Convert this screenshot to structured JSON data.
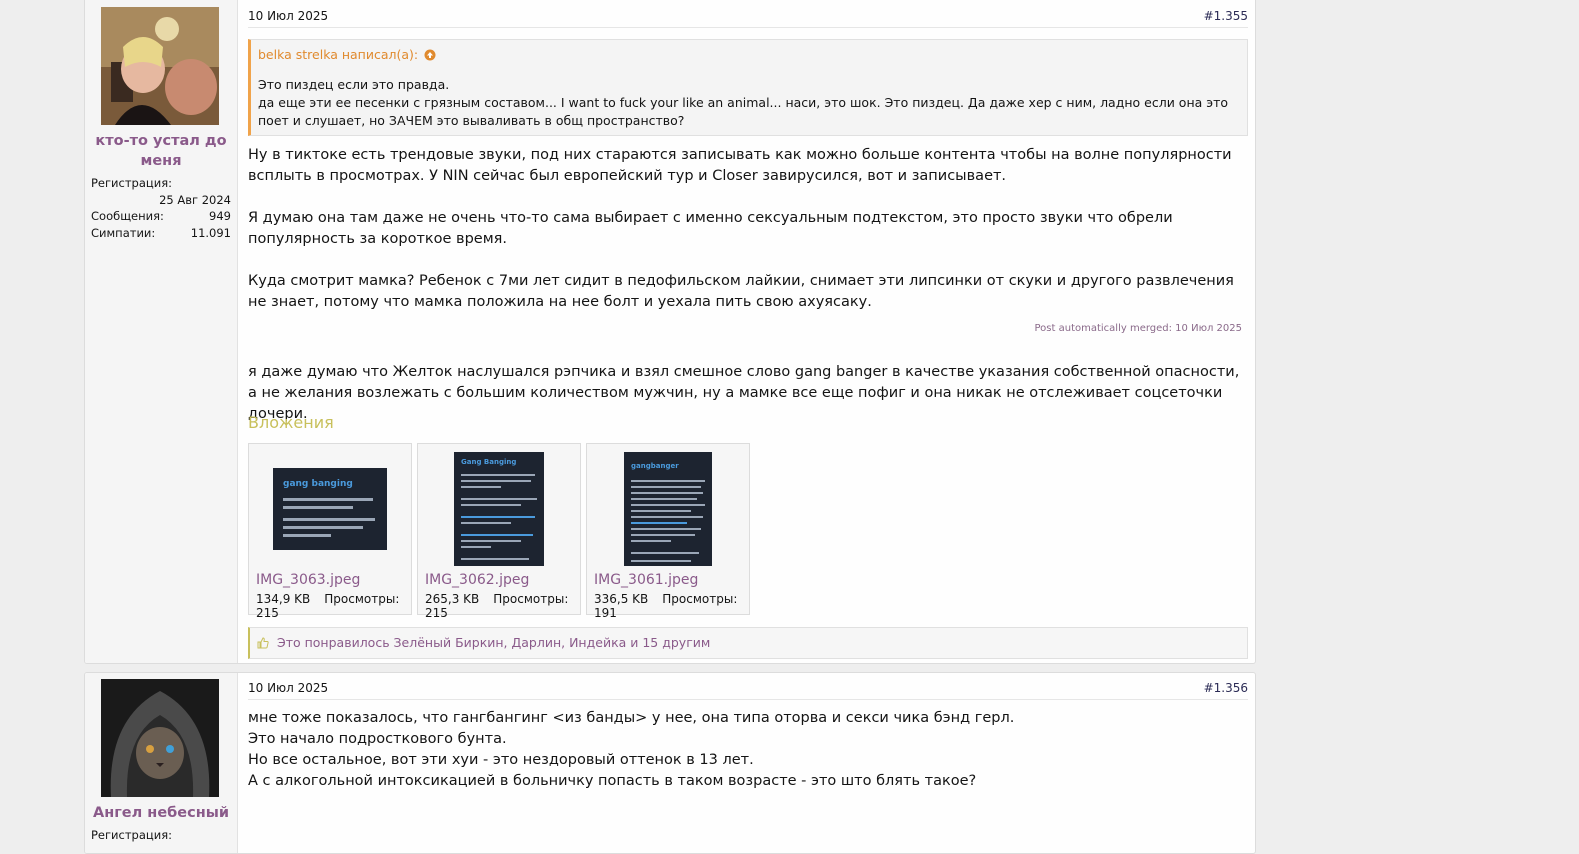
{
  "posts": [
    {
      "username": "кто-то устал до меня",
      "stats": {
        "reg_label": "Регистрация:",
        "reg_value": "25 Авг 2024",
        "msgs_label": "Сообщения:",
        "msgs_value": "949",
        "likes_label": "Симпатии:",
        "likes_value": "11.091"
      },
      "date": "10 Июл 2025",
      "number": "#1.355",
      "quote": {
        "author": "belka strelka написал(а):",
        "line1": "Это пиздец если это правда.",
        "line2": "да еще эти ее песенки с грязным составом... I want to fuck your like an animal... наси, это шок. Это пиздец. Да даже хер с ним, ладно если она это поет и слушает, но ЗАЧЕМ это вываливать в общ пространство?"
      },
      "paragraphs": [
        "Ну в тиктоке есть трендовые звуки, под них стараются записывать как можно больше контента чтобы на волне популярности всплыть в просмотрах. У NIN сейчас был европейский тур и Closer завирусился, вот и записывает.",
        "Я думаю она там даже не очень что-то сама выбирает с именно сексуальным подтекстом, это просто звуки что обрели популярность за короткое время.",
        "Куда смотрит мамка? Ребенок с 7ми лет сидит в педофильском лайкии, снимает эти липсинки от скуки и другого развлечения не знает, потому что мамка положила на нее болт и уехала пить свою ахуясаку."
      ],
      "merged_note": "Post automatically merged: 10 Июл 2025",
      "paragraph_after": "я даже думаю что Желток наслушался рэпчика и взял смешное слово gang banger в качестве указания собственной опасности, а не желания возлежать с большим количеством мужчин, ну а мамке все еще пофиг и она никак не отслеживает соцсеточки дочери.",
      "attachments_title": "Вложения",
      "attachments": [
        {
          "name": "IMG_3063.jpeg",
          "size": "134,9 KB",
          "views": "Просмотры: 215",
          "thumb_title": "gang banging"
        },
        {
          "name": "IMG_3062.jpeg",
          "size": "265,3 KB",
          "views": "Просмотры: 215",
          "thumb_title": "Gang Banging"
        },
        {
          "name": "IMG_3061.jpeg",
          "size": "336,5 KB",
          "views": "Просмотры: 191",
          "thumb_title": "gangbanger"
        }
      ],
      "likes_text": "Это понравилось Зелёный Биркин, Дарлин, Индейка и 15 другим"
    },
    {
      "username": "Ангел небесный",
      "stats": {
        "reg_label": "Регистрация:"
      },
      "date": "10 Июл 2025",
      "number": "#1.356",
      "lines": [
        "мне тоже показалось, что гангбангинг <из банды> у нее, она типа оторва и секси чика бэнд герл.",
        "Это начало подросткового бунта.",
        "Но все остальное, вот эти хуи - это нездоровый оттенок в 13 лет.",
        "А с алкогольной интоксикацией в больничку попасть в таком возрасте - это што блять такое?"
      ]
    }
  ],
  "colors": {
    "username": "#8a5a8a",
    "quote_accent": "#f0a34a",
    "attach_title": "#c8c05c"
  }
}
